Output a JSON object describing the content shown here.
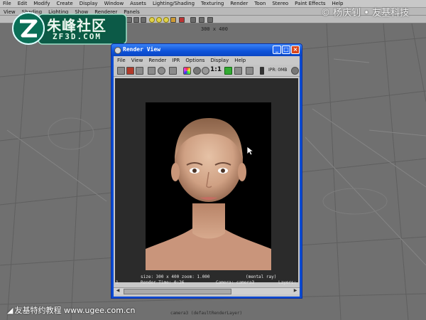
{
  "maya": {
    "menu": [
      "File",
      "Edit",
      "Modify",
      "Create",
      "Display",
      "Window",
      "Assets",
      "Lighting/Shading",
      "Texturing",
      "Render",
      "Toon",
      "Stereo",
      "Paint Effects",
      "Help"
    ],
    "panel_menu": [
      "View",
      "Shading",
      "Lighting",
      "Show",
      "Renderer",
      "Panels"
    ],
    "resolution_gate": "300 x 400",
    "camera_label": "camera3 (defaultRenderLayer)"
  },
  "watermarks": {
    "logo_cn": "朱峰社区",
    "logo_en": "ZF3D.COM",
    "copyright": "© 杨庆钊 • 友基科技",
    "bottom": "友基特约教程 www.ugee.com.cn"
  },
  "render_view": {
    "title": "Render View",
    "menu": [
      "File",
      "View",
      "Render",
      "IPR",
      "Options",
      "Display",
      "Help"
    ],
    "ratio_label": "1:1",
    "ipr_label": "IPR: 0MB",
    "info_line1_left": "size: 300 x 400 zoom: 1.000",
    "info_line1_right": "(mental ray)",
    "info_line2_left": "1",
    "info_line2_mid": "Render Time: 0:26",
    "info_line2_cam": "Camera: camera3",
    "info_line2_right": "Layers:"
  },
  "colors": {
    "xp_title_blue": "#0d52d9",
    "close_red": "#d9461c",
    "viewport_gray": "#707070",
    "logo_teal": "#0a6f57"
  },
  "icons": [
    "render-view-app-icon",
    "minimize-icon",
    "maximize-icon",
    "close-icon",
    "mouse-cursor-icon",
    "zf3d-logo-icon",
    "bird-icon"
  ]
}
